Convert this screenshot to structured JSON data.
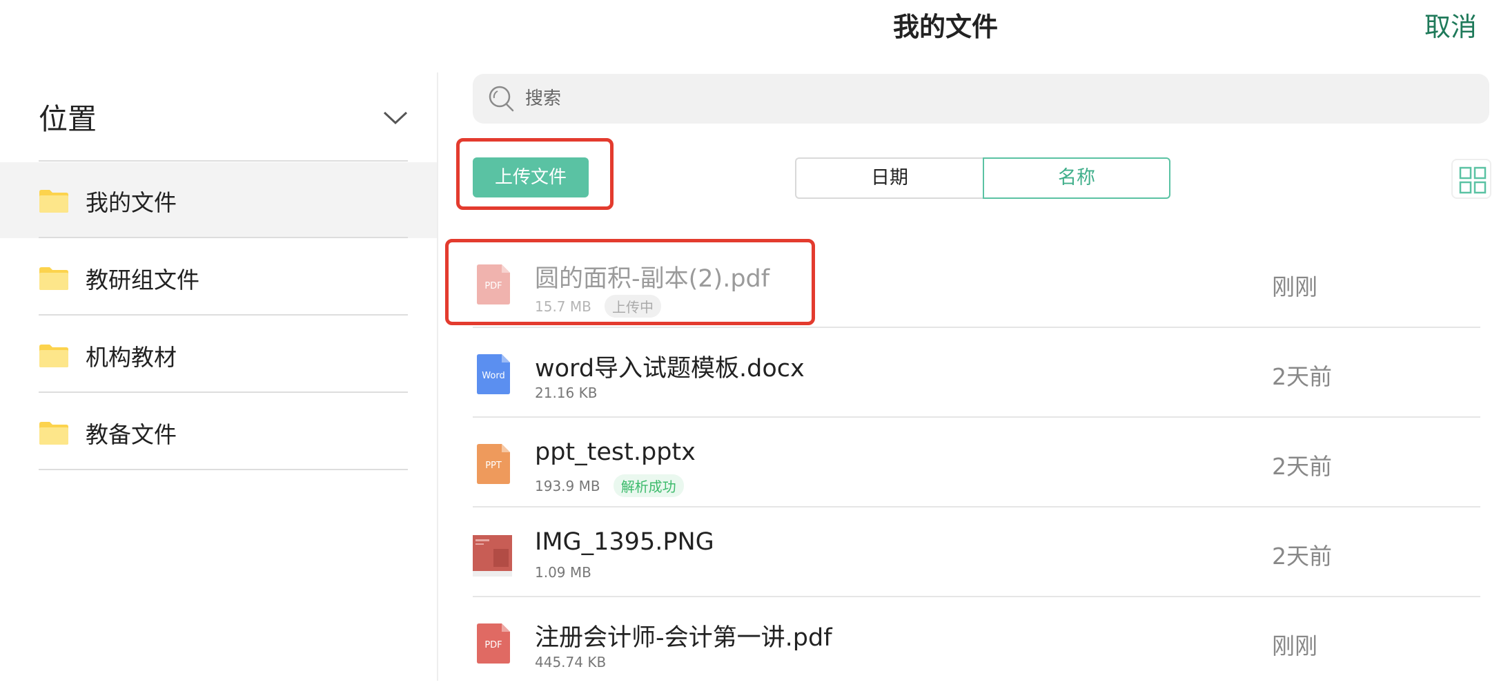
{
  "header": {
    "title": "我的文件",
    "cancel_label": "取消"
  },
  "sidebar": {
    "location_title": "位置",
    "items": [
      {
        "label": "我的文件",
        "active": true
      },
      {
        "label": "教研组文件",
        "active": false
      },
      {
        "label": "机构教材",
        "active": false
      },
      {
        "label": "教备文件",
        "active": false
      }
    ]
  },
  "search": {
    "placeholder": "搜索",
    "value": ""
  },
  "toolbar": {
    "upload_label": "上传文件",
    "sort_date_label": "日期",
    "sort_name_label": "名称",
    "sort_selected": "名称"
  },
  "files": [
    {
      "name": "圆的面积-副本(2).pdf",
      "size": "15.7 MB",
      "status": "上传中",
      "time": "刚刚",
      "type": "PDF",
      "icon": "pdf-icon"
    },
    {
      "name": "word导入试题模板.docx",
      "size": "21.16 KB",
      "status": "",
      "time": "2天前",
      "type": "Word",
      "icon": "word-icon"
    },
    {
      "name": "ppt_test.pptx",
      "size": "193.9 MB",
      "status": "解析成功",
      "time": "2天前",
      "type": "PPT",
      "icon": "ppt-icon"
    },
    {
      "name": "IMG_1395.PNG",
      "size": "1.09 MB",
      "status": "",
      "time": "2天前",
      "type": "",
      "icon": "image-thumbnail"
    },
    {
      "name": "注册会计师-会计第一讲.pdf",
      "size": "445.74 KB",
      "status": "",
      "time": "刚刚",
      "type": "PDF",
      "icon": "pdf-icon"
    }
  ],
  "colors": {
    "accent": "#5ac2a3",
    "cancel": "#1f7a5a",
    "highlight": "#e33b2e",
    "folder": "#fcd34d",
    "pdf": "#e06a63",
    "word": "#5b8ff0",
    "ppt": "#ee9a5c"
  }
}
